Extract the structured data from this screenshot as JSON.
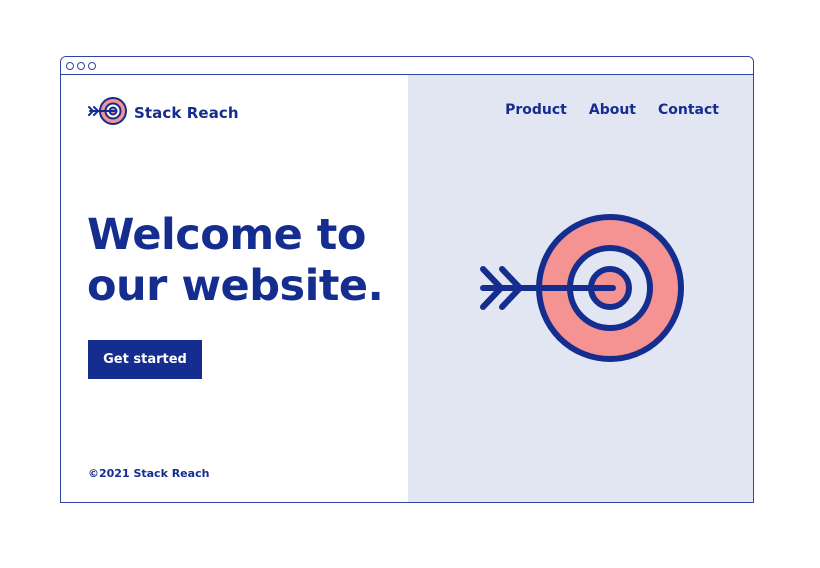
{
  "brand": {
    "name": "Stack Reach",
    "logo_icon": "target-arrow-icon"
  },
  "nav": {
    "items": [
      {
        "label": "Product"
      },
      {
        "label": "About"
      },
      {
        "label": "Contact"
      }
    ]
  },
  "hero": {
    "headline_line1": "Welcome to",
    "headline_line2": "our website.",
    "cta_label": "Get started",
    "illustration_icon": "target-arrow-icon"
  },
  "footer": {
    "copyright": "©2021 Stack Reach"
  },
  "colors": {
    "primary": "#142d8f",
    "accent": "#f49391",
    "panel": "#e2e6f2",
    "window_border": "#2f45a4"
  }
}
